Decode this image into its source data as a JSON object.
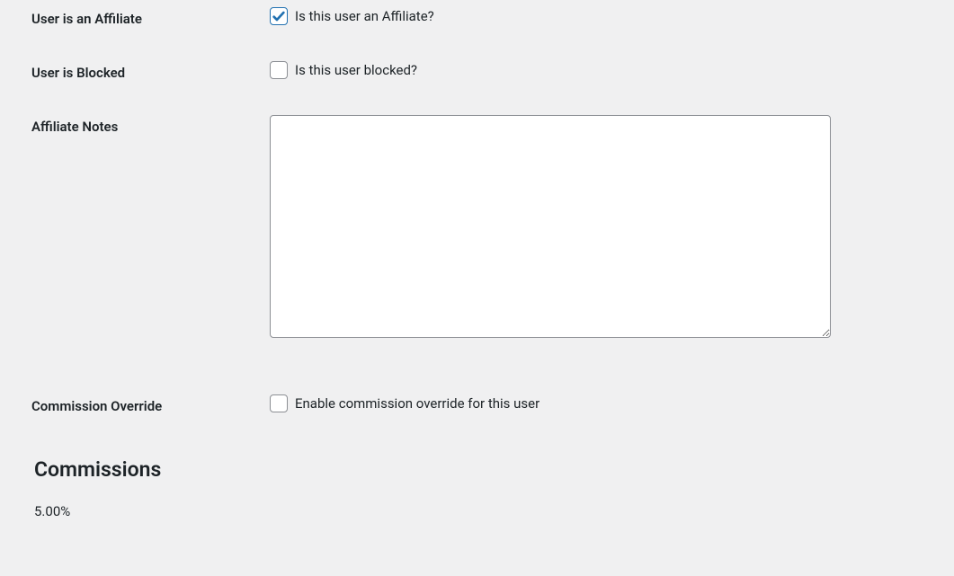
{
  "fields": {
    "affiliate": {
      "label": "User is an Affiliate",
      "desc": "Is this user an Affiliate?",
      "checked": true
    },
    "blocked": {
      "label": "User is Blocked",
      "desc": "Is this user blocked?",
      "checked": false
    },
    "notes": {
      "label": "Affiliate Notes",
      "value": ""
    },
    "override": {
      "label": "Commission Override",
      "desc": "Enable commission override for this user",
      "checked": false
    }
  },
  "commissions": {
    "heading": "Commissions",
    "value": "5.00%"
  }
}
